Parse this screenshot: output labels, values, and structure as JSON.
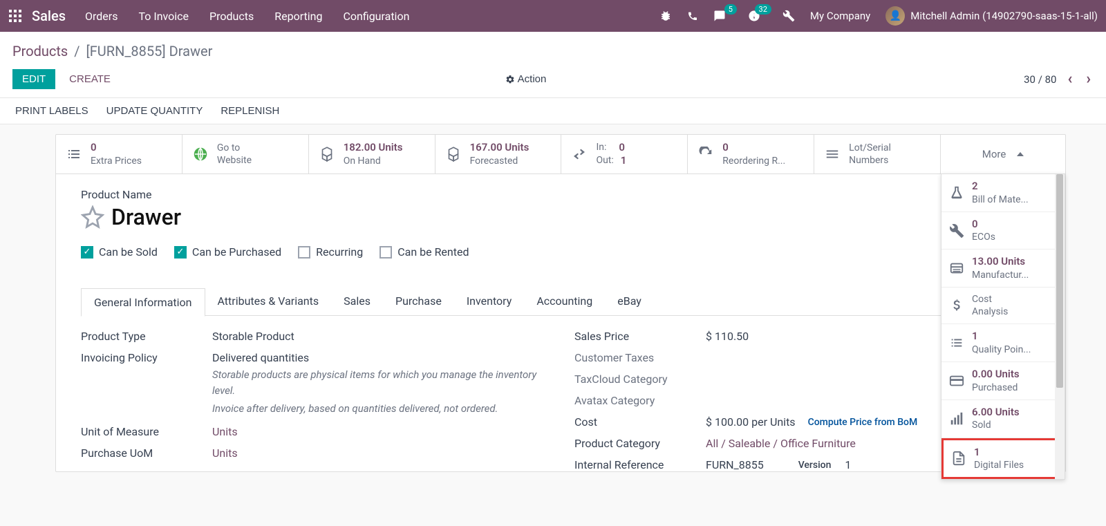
{
  "nav": {
    "brand": "Sales",
    "menu": [
      "Orders",
      "To Invoice",
      "Products",
      "Reporting",
      "Configuration"
    ],
    "conversations_badge": "5",
    "activities_badge": "32",
    "company": "My Company",
    "user": "Mitchell Admin (14902790-saas-15-1-all)"
  },
  "breadcrumb": {
    "root": "Products",
    "current": "[FURN_8855] Drawer"
  },
  "buttons": {
    "edit": "EDIT",
    "create": "CREATE",
    "action": "Action"
  },
  "pager": {
    "text": "30 / 80"
  },
  "statusbar": {
    "print_labels": "PRINT LABELS",
    "update_qty": "UPDATE QUANTITY",
    "replenish": "REPLENISH"
  },
  "stats": {
    "extra_prices": {
      "value": "0",
      "label": "Extra Prices"
    },
    "website": {
      "value": "Go to",
      "label": "Website"
    },
    "on_hand": {
      "value": "182.00 Units",
      "label": "On Hand"
    },
    "forecasted": {
      "value": "167.00 Units",
      "label": "Forecasted"
    },
    "in_out": {
      "in_label": "In:",
      "in_value": "0",
      "out_label": "Out:",
      "out_value": "1"
    },
    "reordering": {
      "value": "0",
      "label": "Reordering R..."
    },
    "lot": {
      "value": "",
      "label": "Lot/Serial Numbers",
      "label_line1": "Lot/Serial",
      "label_line2": "Numbers"
    },
    "more": "More"
  },
  "more_dropdown": [
    {
      "value": "2",
      "label": "Bill of Mate...",
      "icon": "flask"
    },
    {
      "value": "0",
      "label": "ECOs",
      "icon": "wrench"
    },
    {
      "value": "13.00 Units",
      "label": "Manufactur...",
      "icon": "card"
    },
    {
      "value": "",
      "label": "Cost Analysis",
      "label_line1": "Cost",
      "label_line2": "Analysis",
      "icon": "dollar"
    },
    {
      "value": "1",
      "label": "Quality Poin...",
      "icon": "list"
    },
    {
      "value": "0.00 Units",
      "label": "Purchased",
      "icon": "credit-card"
    },
    {
      "value": "6.00 Units",
      "label": "Sold",
      "icon": "bars"
    },
    {
      "value": "1",
      "label": "Digital Files",
      "icon": "file",
      "highlight": true
    }
  ],
  "product": {
    "name_label": "Product Name",
    "name": "Drawer",
    "checks": {
      "can_be_sold": {
        "label": "Can be Sold",
        "checked": true
      },
      "can_be_purchased": {
        "label": "Can be Purchased",
        "checked": true
      },
      "recurring": {
        "label": "Recurring",
        "checked": false
      },
      "can_be_rented": {
        "label": "Can be Rented",
        "checked": false
      }
    }
  },
  "tabs": [
    "General Information",
    "Attributes & Variants",
    "Sales",
    "Purchase",
    "Inventory",
    "Accounting",
    "eBay"
  ],
  "fields_left": {
    "product_type": {
      "label": "Product Type",
      "value": "Storable Product"
    },
    "invoicing_policy": {
      "label": "Invoicing Policy",
      "value": "Delivered quantities"
    },
    "help1": "Storable products are physical items for which you manage the inventory level.",
    "help2": "Invoice after delivery, based on quantities delivered, not ordered.",
    "uom": {
      "label": "Unit of Measure",
      "value": "Units"
    },
    "purchase_uom": {
      "label": "Purchase UoM",
      "value": "Units"
    }
  },
  "fields_right": {
    "sales_price": {
      "label": "Sales Price",
      "value": "$ 110.50"
    },
    "customer_taxes": {
      "label": "Customer Taxes"
    },
    "taxcloud": {
      "label": "TaxCloud Category"
    },
    "avatax": {
      "label": "Avatax Category"
    },
    "cost": {
      "label": "Cost",
      "value": "$ 100.00 per Units",
      "compute": "Compute Price from BoM"
    },
    "category": {
      "label": "Product Category",
      "value": "All / Saleable / Office Furniture"
    },
    "internal_ref": {
      "label": "Internal Reference",
      "value": "FURN_8855",
      "version_label": "Version",
      "version_value": "1"
    }
  }
}
